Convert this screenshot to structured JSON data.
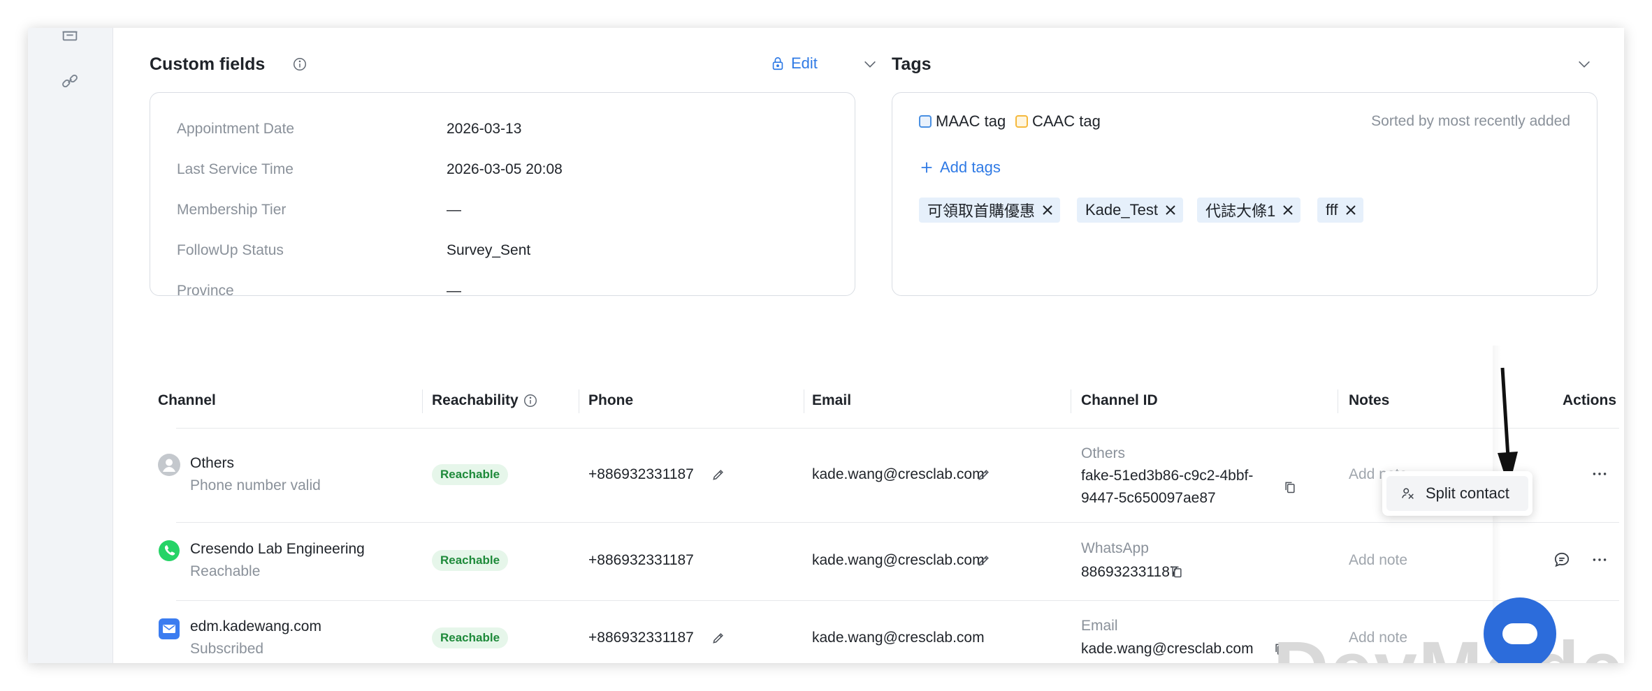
{
  "custom_fields": {
    "title": "Custom fields",
    "edit_label": "Edit",
    "rows": [
      {
        "label": "Appointment Date",
        "value": "2026-03-13"
      },
      {
        "label": "Last Service Time",
        "value": "2026-03-05 20:08"
      },
      {
        "label": "Membership Tier",
        "value": "—"
      },
      {
        "label": "FollowUp Status",
        "value": "Survey_Sent"
      },
      {
        "label": "Province",
        "value": "—"
      }
    ]
  },
  "tags": {
    "title": "Tags",
    "filters": [
      {
        "label": "MAAC tag",
        "color": "#4a90e2"
      },
      {
        "label": "CAAC tag",
        "color": "#f5b93d"
      }
    ],
    "sort_note": "Sorted by most recently added",
    "add_label": "Add tags",
    "chips": [
      "可領取首購優惠",
      "Kade_Test",
      "代誌大條1",
      "fff"
    ]
  },
  "table": {
    "headers": [
      "Channel",
      "Reachability",
      "Phone",
      "Email",
      "Channel ID",
      "Notes",
      "Actions"
    ],
    "rows": [
      {
        "icon": "person-icon",
        "channel": "Others",
        "channel_sub": "Phone number valid",
        "reachability": "Reachable",
        "phone": "+886932331187",
        "email": "kade.wang@cresclab.com",
        "channel_id_type": "Others",
        "channel_id_line1": "fake-51ed3b86-c9c2-4bbf-",
        "channel_id_line2": "9447-5c650097ae87",
        "notes": "Add note"
      },
      {
        "icon": "whatsapp-icon",
        "channel": "Cresendo Lab Engineering",
        "channel_sub": "Reachable",
        "reachability": "Reachable",
        "phone": "+886932331187",
        "email": "kade.wang@cresclab.com",
        "channel_id_type": "WhatsApp",
        "channel_id_line1": "886932331187",
        "notes": "Add note"
      },
      {
        "icon": "email-icon",
        "channel": "edm.kadewang.com",
        "channel_sub": "Subscribed",
        "reachability": "Reachable",
        "phone": "+886932331187",
        "email": "kade.wang@cresclab.com",
        "channel_id_type": "Email",
        "channel_id_line1": "kade.wang@cresclab.com",
        "notes": "Add note"
      }
    ]
  },
  "context_menu": {
    "split_contact": "Split contact"
  },
  "watermark": "DevMode",
  "colors": {
    "accent": "#2f7ae5",
    "reachable_bg": "#e6f6ea",
    "reachable_text": "#1e8a3a",
    "fab": "#2c6cdb"
  }
}
